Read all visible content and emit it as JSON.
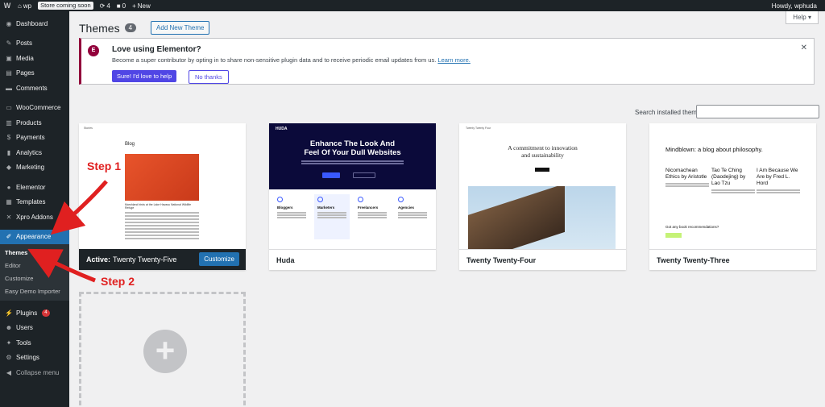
{
  "admin_bar": {
    "site_name": "wp",
    "store_badge": "Store coming soon",
    "updates_count": "4",
    "comments_count": "0",
    "new_label": "New",
    "howdy": "Howdy, wphuda"
  },
  "sidebar": {
    "items": [
      {
        "label": "Dashboard",
        "icon": "dashboard-icon"
      },
      {
        "label": "Posts",
        "icon": "pin-icon"
      },
      {
        "label": "Media",
        "icon": "media-icon"
      },
      {
        "label": "Pages",
        "icon": "pages-icon"
      },
      {
        "label": "Comments",
        "icon": "comments-icon"
      },
      {
        "label": "WooCommerce",
        "icon": "woocommerce-icon"
      },
      {
        "label": "Products",
        "icon": "products-icon"
      },
      {
        "label": "Payments",
        "icon": "payments-icon"
      },
      {
        "label": "Analytics",
        "icon": "analytics-icon"
      },
      {
        "label": "Marketing",
        "icon": "marketing-icon"
      },
      {
        "label": "Elementor",
        "icon": "elementor-icon"
      },
      {
        "label": "Templates",
        "icon": "templates-icon"
      },
      {
        "label": "Xpro Addons",
        "icon": "xpro-icon"
      },
      {
        "label": "Appearance",
        "icon": "appearance-icon"
      },
      {
        "label": "Plugins",
        "icon": "plugins-icon",
        "badge": "4"
      },
      {
        "label": "Users",
        "icon": "users-icon"
      },
      {
        "label": "Tools",
        "icon": "tools-icon"
      },
      {
        "label": "Settings",
        "icon": "settings-icon"
      }
    ],
    "appearance_sub": [
      "Themes",
      "Editor",
      "Customize",
      "Easy Demo Importer"
    ],
    "collapse_label": "Collapse menu"
  },
  "header": {
    "title": "Themes",
    "count": "4",
    "add_new": "Add New Theme",
    "help": "Help"
  },
  "notice": {
    "title": "Love using Elementor?",
    "text": "Become a super contributor by opting in to share non-sensitive plugin data and to receive periodic email updates from us.",
    "link": "Learn more.",
    "primary": "Sure! I'd love to help",
    "secondary": "No thanks"
  },
  "search": {
    "label": "Search installed themes"
  },
  "themes": [
    {
      "name": "Twenty Twenty-Five",
      "active_prefix": "Active:",
      "customize": "Customize"
    },
    {
      "name": "Huda"
    },
    {
      "name": "Twenty Twenty-Four"
    },
    {
      "name": "Twenty Twenty-Three"
    }
  ],
  "previews": {
    "tt5": {
      "blog": "Blog",
      "caption": "Marshland birds at the Lake Havasu National Wildlife Refuge",
      "nav": "Stories"
    },
    "huda": {
      "logo": "HUDA",
      "headline_1": "Enhance The Look And",
      "headline_2": "Feel Of Your Dull Websites",
      "cols": [
        "Bloggers",
        "Marketers",
        "Freelancers",
        "Agencies"
      ]
    },
    "tt4": {
      "nav": "Twenty Twenty Four",
      "headline_1": "A commitment to innovation",
      "headline_2": "and sustainability"
    },
    "tt3": {
      "title": "Mindblown: a blog about philosophy.",
      "col1": "Nicomachean Ethics by Aristotle",
      "col2": "Tao Te Ching (Daodejing) by Lao Tzu",
      "col3": "I Am Because We Are by Fred L. Hord",
      "question": "Got any book recommendations?"
    }
  },
  "annotations": {
    "step1": "Step 1",
    "step2": "Step 2"
  },
  "colors": {
    "admin_dark": "#1d2327",
    "wp_blue": "#2271b1",
    "elementor": "#92003b",
    "annotation_red": "#e02020"
  }
}
